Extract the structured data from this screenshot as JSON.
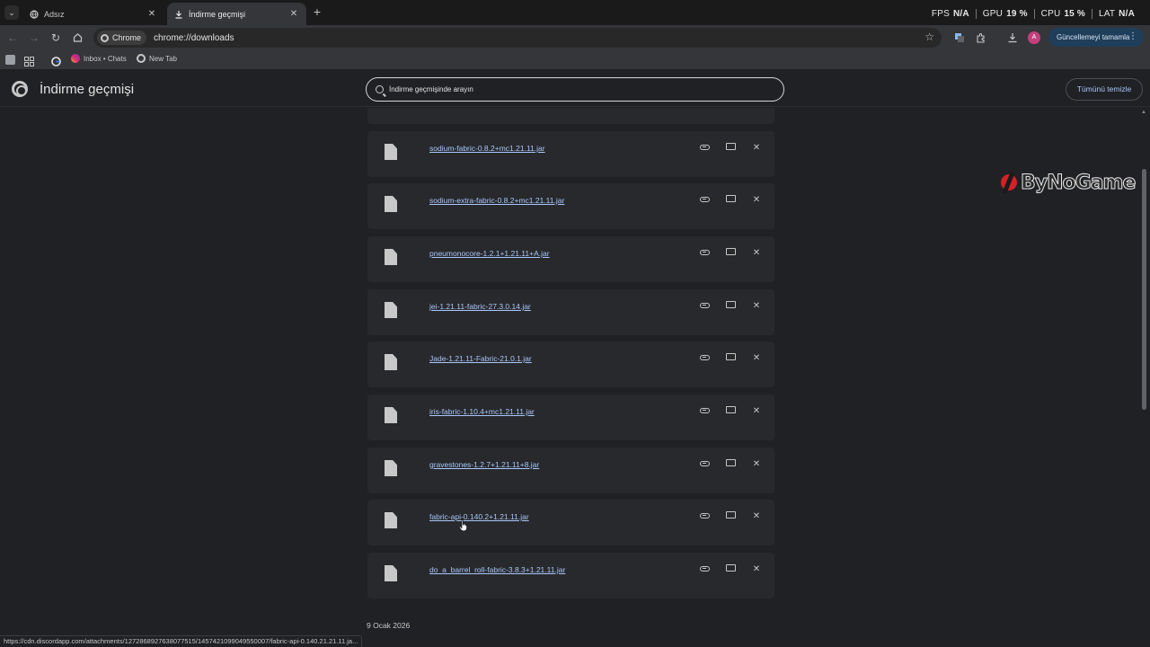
{
  "tabs": [
    {
      "title": "Adsız",
      "active": false
    },
    {
      "title": "İndirme geçmişi",
      "active": true
    }
  ],
  "overlay": {
    "fps_label": "FPS",
    "fps_value": "N/A",
    "gpu_label": "GPU",
    "gpu_value": "19 %",
    "cpu_label": "CPU",
    "cpu_value": "15 %",
    "lat_label": "LAT",
    "lat_value": "N/A"
  },
  "toolbar": {
    "chip_label": "Chrome",
    "url": "chrome://downloads",
    "avatar_letter": "A",
    "update_button_label": "Güncellemeyi tamamla"
  },
  "bookmarks": [
    {
      "label": "Inbox • Chats",
      "icon": "instagram-icon"
    },
    {
      "label": "New Tab",
      "icon": "chrome-icon"
    }
  ],
  "page": {
    "title": "İndirme geçmişi",
    "search_placeholder": "İndirme geçmişinde arayın",
    "clear_all_label": "Tümünü temizle",
    "date_label": "9 Ocak 2026"
  },
  "downloads": [
    {
      "name": "sodium-fabric-0.8.2+mc1.21.11.jar"
    },
    {
      "name": "sodium-extra-fabric-0.8.2+mc1.21.11.jar"
    },
    {
      "name": "pneumonocore-1.2.1+1.21.11+A.jar"
    },
    {
      "name": "jei-1.21.11-fabric-27.3.0.14.jar"
    },
    {
      "name": "Jade-1.21.11-Fabric-21.0.1.jar"
    },
    {
      "name": "iris-fabric-1.10.4+mc1.21.11.jar"
    },
    {
      "name": "gravestones-1.2.7+1.21.11+8.jar"
    },
    {
      "name": "fabric-api-0.140.2+1.21.11.jar"
    },
    {
      "name": "do_a_barrel_roll-fabric-3.8.3+1.21.11.jar"
    }
  ],
  "watermark": {
    "text": "ByNoGame"
  },
  "status_bar": {
    "text": "https://cdn.discordapp.com/attachments/1272868927638077515/1457421099049550007/fabric-api-0.140.21.21.11.ja..."
  },
  "colors": {
    "accent": "#a8c7fa",
    "background": "#202124",
    "card": "#28292c",
    "update_button": "#1f3e5a"
  }
}
